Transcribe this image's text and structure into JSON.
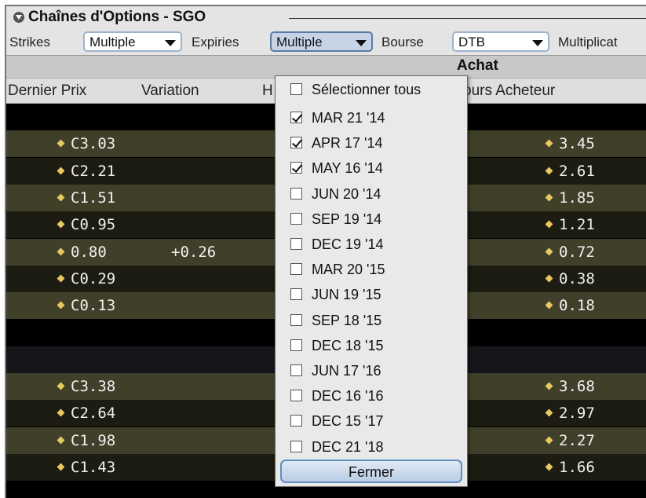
{
  "panel": {
    "title": "Chaînes d'Options - SGO"
  },
  "toolbar": {
    "strikes_label": "Strikes",
    "strikes_value": "Multiple",
    "expiries_label": "Expiries",
    "expiries_value": "Multiple",
    "bourse_label": "Bourse",
    "bourse_value": "DTB",
    "multiplier_label": "Multiplicat"
  },
  "header": {
    "group_achat": "Achat",
    "col_last_price": "Dernier Prix",
    "col_variation": "Variation",
    "col_h_partial": "H",
    "col_bid_partial": "ours Acheteur"
  },
  "rows": [
    {
      "last": "",
      "variation": "",
      "bid": "",
      "kind": "blank1"
    },
    {
      "last": "C3.03",
      "variation": "",
      "bid": "3.45",
      "kind": "odd"
    },
    {
      "last": "C2.21",
      "variation": "",
      "bid": "2.61",
      "kind": "even"
    },
    {
      "last": "C1.51",
      "variation": "",
      "bid": "1.85",
      "kind": "odd"
    },
    {
      "last": "C0.95",
      "variation": "",
      "bid": "1.21",
      "kind": "even"
    },
    {
      "last": "0.80",
      "variation": "+0.26",
      "bid": "0.72",
      "kind": "odd"
    },
    {
      "last": "C0.29",
      "variation": "",
      "bid": "0.38",
      "kind": "even"
    },
    {
      "last": "C0.13",
      "variation": "",
      "bid": "0.18",
      "kind": "odd"
    },
    {
      "last": "",
      "variation": "",
      "bid": "",
      "kind": "blank1"
    },
    {
      "last": "",
      "variation": "",
      "bid": "",
      "kind": "blank2"
    },
    {
      "last": "C3.38",
      "variation": "",
      "bid": "3.68",
      "kind": "odd"
    },
    {
      "last": "C2.64",
      "variation": "",
      "bid": "2.97",
      "kind": "even"
    },
    {
      "last": "C1.98",
      "variation": "",
      "bid": "2.27",
      "kind": "odd"
    },
    {
      "last": "C1.43",
      "variation": "",
      "bid": "1.66",
      "kind": "even"
    }
  ],
  "expiries_popup": {
    "select_all": "Sélectionner tous",
    "options": [
      {
        "label": "MAR 21 '14",
        "checked": true
      },
      {
        "label": "APR 17 '14",
        "checked": true
      },
      {
        "label": "MAY 16 '14",
        "checked": true
      },
      {
        "label": "JUN 20 '14",
        "checked": false
      },
      {
        "label": "SEP 19 '14",
        "checked": false
      },
      {
        "label": "DEC 19 '14",
        "checked": false
      },
      {
        "label": "MAR 20 '15",
        "checked": false
      },
      {
        "label": "JUN 19 '15",
        "checked": false
      },
      {
        "label": "SEP 18 '15",
        "checked": false
      },
      {
        "label": "DEC 18 '15",
        "checked": false
      },
      {
        "label": "JUN 17 '16",
        "checked": false
      },
      {
        "label": "DEC 16 '16",
        "checked": false
      },
      {
        "label": "DEC 15 '17",
        "checked": false
      },
      {
        "label": "DEC 21 '18",
        "checked": false
      }
    ],
    "close_label": "Fermer"
  },
  "colors": {
    "row_odd": "#40402a",
    "row_even": "#1c1c12",
    "diamond": "#e8c860",
    "button_border": "#5f8ec2"
  }
}
